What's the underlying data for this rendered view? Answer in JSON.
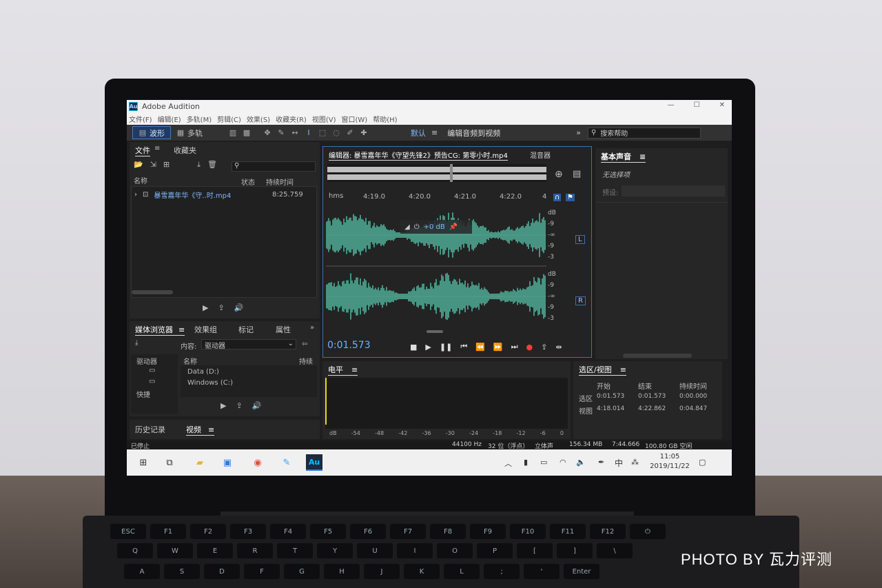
{
  "app": {
    "title": "Adobe Audition",
    "logo": "Au"
  },
  "menu": [
    "文件(F)",
    "编辑(E)",
    "多轨(M)",
    "剪辑(C)",
    "效果(S)",
    "收藏夹(R)",
    "视图(V)",
    "窗口(W)",
    "帮助(H)"
  ],
  "toolbar": {
    "waveform": "波形",
    "multitrack": "多轨",
    "workspace": "默认",
    "edit_to_video": "编辑音频到视频",
    "search_placeholder": "搜索帮助"
  },
  "files_panel": {
    "tab_files": "文件",
    "tab_favorites": "收藏夹",
    "col_name": "名称",
    "col_status": "状态",
    "col_duration": "持续时间",
    "file_name": "暴雪嘉年华《守..时.mp4",
    "file_duration": "8:25.759"
  },
  "editor": {
    "tab_editor": "编辑器: 暴雪嘉年华《守望先锋2》预告CG: 第零小时.mp4",
    "tab_mixer": "混音器",
    "ruler_unit": "hms",
    "ruler_ticks": [
      "4:19.0",
      "4:20.0",
      "4:21.0",
      "4:22.0",
      "4"
    ],
    "gain_label": "+0 dB",
    "db_labels_L": [
      "dB",
      "-9",
      "-∞",
      "-9",
      "-3"
    ],
    "db_labels_R": [
      "dB",
      "-9",
      "-∞",
      "-9",
      "-3"
    ],
    "channel_L": "L",
    "channel_R": "R",
    "current_time": "0:01.573",
    "waveform_color": "#5fe0c0"
  },
  "essential_sound": {
    "title": "基本声音",
    "no_selection": "无选择项",
    "preset_label": "预设:"
  },
  "media_browser": {
    "tab_media": "媒体浏览器",
    "tab_effects": "效果组",
    "tab_markers": "标记",
    "tab_properties": "属性",
    "content_label": "内容:",
    "content_value": "驱动器",
    "tree_drives": "驱动器",
    "tree_shortcuts": "快捷",
    "col_name": "名称",
    "col_duration": "持续",
    "item_d": "Data (D:)",
    "item_c": "Windows (C:)"
  },
  "bottom_left": {
    "tab_history": "历史记录",
    "tab_video": "视频"
  },
  "levels": {
    "title": "电平",
    "scale": [
      "dB",
      "-54",
      "-48",
      "-42",
      "-36",
      "-30",
      "-24",
      "-18",
      "-12",
      "-6",
      "0"
    ]
  },
  "selection_view": {
    "title": "选区/视图",
    "col_start": "开始",
    "col_end": "结束",
    "col_duration": "持续时间",
    "row_selection": "选区",
    "row_view": "视图",
    "sel_start": "0:01.573",
    "sel_end": "0:01.573",
    "sel_dur": "0:00.000",
    "view_start": "4:18.014",
    "view_end": "4:22.862",
    "view_dur": "0:04.847"
  },
  "status": {
    "left": "已停止",
    "sample_rate": "44100 Hz",
    "bit_depth": "32 位（浮点）",
    "channels": "立体声",
    "file_size": "156.34 MB",
    "duration": "7:44.666",
    "free_space": "100.80 GB 空闲"
  },
  "taskbar": {
    "time": "11:05",
    "date": "2019/11/22",
    "ime": "中"
  },
  "watermark": "PHOTO  BY  瓦力评测"
}
